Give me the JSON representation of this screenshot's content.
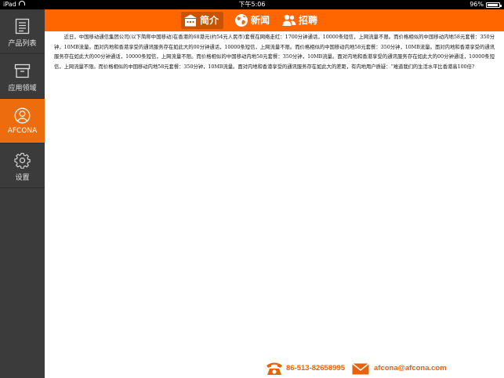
{
  "status_bar": {
    "carrier": "iPad",
    "time": "下午5:06",
    "battery_percent": "96%",
    "battery_level": 0.96
  },
  "sidebar": {
    "items": [
      {
        "label": "产品列表",
        "icon": "list-icon",
        "active": false
      },
      {
        "label": "应用领域",
        "icon": "box-icon",
        "active": false
      },
      {
        "label": "AFCONA",
        "icon": "person-icon",
        "active": true
      },
      {
        "label": "设置",
        "icon": "gear-icon",
        "active": false
      }
    ]
  },
  "nav": {
    "tabs": [
      {
        "label": "简介",
        "icon": "building-icon",
        "active": true
      },
      {
        "label": "新闻",
        "icon": "globe-icon",
        "active": false
      },
      {
        "label": "招聘",
        "icon": "people-icon",
        "active": false
      }
    ]
  },
  "article": {
    "body": "近日，中国移动通信集团公司(以下简称中国移动)在香港的68港元(约54元人民币)套餐在网络走红：1700分钟通话，10000条短信，上网流量不限。而价格相似的中国移动内地58元套餐：350分钟，10MB流量。面对内地和香港享受的通讯服务存在如此大的00分钟通话，10000条短信，上网流量不限。而价格相似的中国移动内地58元套餐：350分钟，10MB流量。面对内地和香港享受的通讯服务存在如此大的00分钟通话，10000条短信，上网流量不限。而价格相似的中国移动内地58元套餐：350分钟，10MB流量。面对内地和香港享受的通讯服务存在如此大的00分钟通话，10000条短信，上网流量不限。而价格相似的中国移动内地58元套餐：350分钟，10MB流量。面对内地和香港享受的通讯服务存在如此大的差距，有内地用户质疑：“难道我们的生活水平比香港高100倍?"
  },
  "contact": {
    "phone": "86-513-82658995",
    "email": "afcona@afcona.com"
  },
  "colors": {
    "accent": "#ff6600",
    "active_tab": "#c85400",
    "sidebar_bg": "#3b3b3b",
    "contact_text": "#e8620c"
  }
}
